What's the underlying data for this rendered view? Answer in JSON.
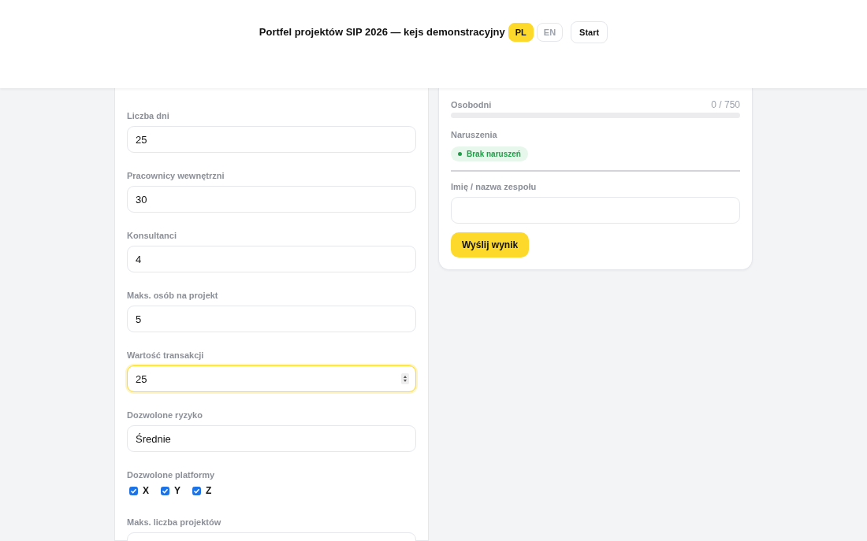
{
  "header": {
    "title": "Portfel projektów SIP 2026 — kejs demonstracyjny",
    "languages": [
      {
        "label": "PL",
        "selected": true
      },
      {
        "label": "EN",
        "selected": false
      }
    ],
    "start_button": "Start"
  },
  "form": {
    "fields": [
      {
        "kind": "input",
        "label": "Liczba dni",
        "value": "25",
        "focused": false
      },
      {
        "kind": "input",
        "label": "Pracownicy wewnętrzni",
        "value": "30",
        "focused": false
      },
      {
        "kind": "input",
        "label": "Konsultanci",
        "value": "4",
        "focused": false
      },
      {
        "kind": "input",
        "label": "Maks. osób na projekt",
        "value": "5",
        "focused": false
      },
      {
        "kind": "input",
        "label": "Wartość transakcji",
        "value": "25",
        "focused": true
      },
      {
        "kind": "input",
        "label": "Dozwolone ryzyko",
        "value": "Średnie",
        "focused": false
      },
      {
        "kind": "checkboxes",
        "label": "Dozwolone platformy",
        "options": [
          {
            "label": "X",
            "checked": true
          },
          {
            "label": "Y",
            "checked": true
          },
          {
            "label": "Z",
            "checked": true
          }
        ]
      },
      {
        "kind": "input",
        "label": "Maks. liczba projektów",
        "focused": false
      }
    ]
  },
  "summary": {
    "meters": [
      {
        "label": "Osobodni",
        "reading": "0 / 750",
        "level": 0
      }
    ],
    "violations": {
      "label": "Naruszenia",
      "badge": "Brak naruszeń"
    },
    "name_field": {
      "label": "Imię / nazwa zespołu"
    },
    "submit_button": "Wyślij wynik"
  }
}
